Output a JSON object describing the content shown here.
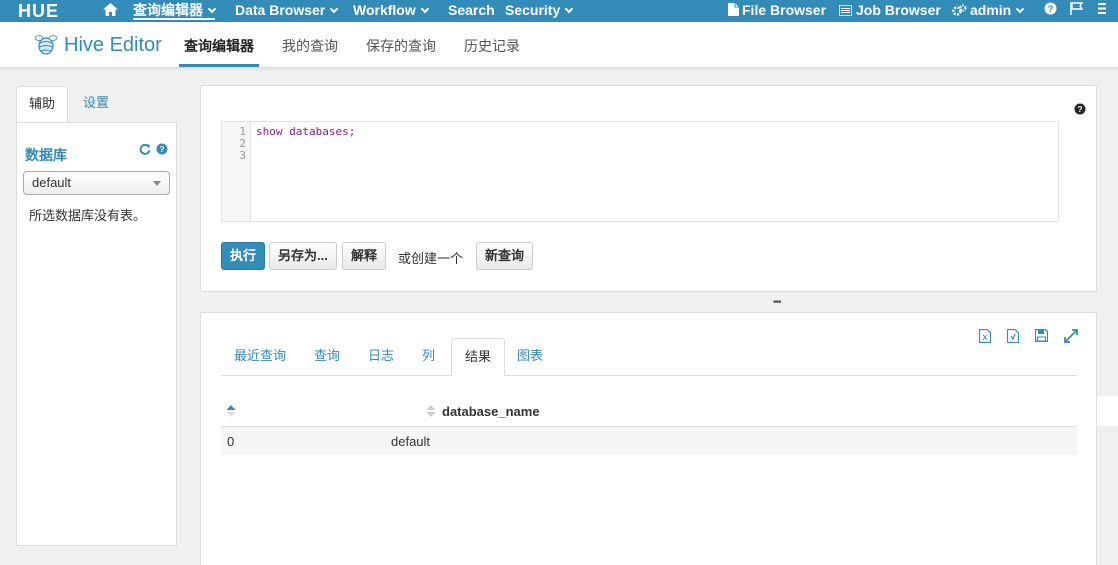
{
  "topnav": {
    "logo": "HUE",
    "items": [
      {
        "label": "查询编辑器"
      },
      {
        "label": "Data Browser"
      },
      {
        "label": "Workflow"
      },
      {
        "label": "Search"
      },
      {
        "label": "Security"
      }
    ],
    "right": {
      "file_browser": "File Browser",
      "job_browser": "Job Browser",
      "user": "admin"
    }
  },
  "subheader": {
    "app_name": "Hive Editor",
    "tabs": [
      {
        "label": "查询编辑器"
      },
      {
        "label": "我的查询"
      },
      {
        "label": "保存的查询"
      },
      {
        "label": "历史记录"
      }
    ]
  },
  "sidebar": {
    "tabs": [
      {
        "label": "辅助"
      },
      {
        "label": "设置"
      }
    ],
    "db_title": "数据库",
    "db_selected": "default",
    "empty_text": "所选数据库没有表。"
  },
  "editor": {
    "line_numbers": "1\n2\n3",
    "code": "show databases;",
    "buttons": {
      "execute": "执行",
      "save_as": "另存为...",
      "explain": "解释",
      "or_create": "或创建一个",
      "new_query": "新查询"
    }
  },
  "results": {
    "tabs": [
      {
        "label": "最近查询"
      },
      {
        "label": "查询"
      },
      {
        "label": "日志"
      },
      {
        "label": "列"
      },
      {
        "label": "结果"
      },
      {
        "label": "图表"
      }
    ],
    "column": "database_name",
    "rows": [
      {
        "index": "0",
        "value": "default"
      }
    ]
  },
  "colors": {
    "accent": "#338bb8",
    "nav_bg": "#338bb8"
  }
}
